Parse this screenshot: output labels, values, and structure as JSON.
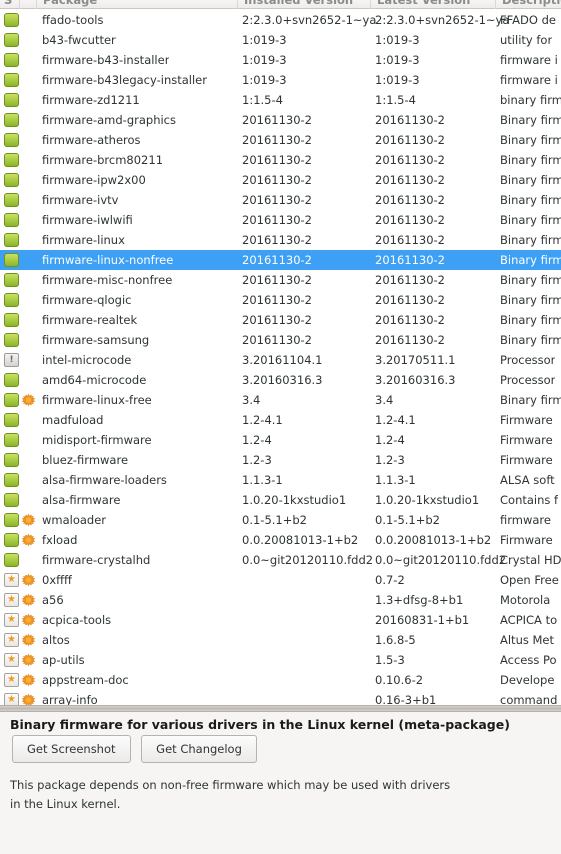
{
  "columns": {
    "status": "S",
    "package": "Package",
    "installed_version": "Installed Version",
    "latest_version": "Latest Version",
    "description": "Description"
  },
  "colors": {
    "selection": "#3da0f5",
    "installed_icon": "#8db528",
    "new_icon": "#f09a21",
    "supported_icon": "#f5941d"
  },
  "rows": [
    {
      "status": "installed",
      "supported": false,
      "name": "ffado-tools",
      "installed": "2:2.3.0+svn2652-1~ya",
      "latest": "2:2.3.0+svn2652-1~ya",
      "desc": "FFADO de"
    },
    {
      "status": "installed",
      "supported": false,
      "name": "b43-fwcutter",
      "installed": "1:019-3",
      "latest": "1:019-3",
      "desc": "utility for"
    },
    {
      "status": "installed",
      "supported": false,
      "name": "firmware-b43-installer",
      "installed": "1:019-3",
      "latest": "1:019-3",
      "desc": "firmware i"
    },
    {
      "status": "installed",
      "supported": false,
      "name": "firmware-b43legacy-installer",
      "installed": "1:019-3",
      "latest": "1:019-3",
      "desc": "firmware i"
    },
    {
      "status": "installed",
      "supported": false,
      "name": "firmware-zd1211",
      "installed": "1:1.5-4",
      "latest": "1:1.5-4",
      "desc": "binary firm"
    },
    {
      "status": "installed",
      "supported": false,
      "name": "firmware-amd-graphics",
      "installed": "20161130-2",
      "latest": "20161130-2",
      "desc": "Binary firm"
    },
    {
      "status": "installed",
      "supported": false,
      "name": "firmware-atheros",
      "installed": "20161130-2",
      "latest": "20161130-2",
      "desc": "Binary firm"
    },
    {
      "status": "installed",
      "supported": false,
      "name": "firmware-brcm80211",
      "installed": "20161130-2",
      "latest": "20161130-2",
      "desc": "Binary firm"
    },
    {
      "status": "installed",
      "supported": false,
      "name": "firmware-ipw2x00",
      "installed": "20161130-2",
      "latest": "20161130-2",
      "desc": "Binary firm"
    },
    {
      "status": "installed",
      "supported": false,
      "name": "firmware-ivtv",
      "installed": "20161130-2",
      "latest": "20161130-2",
      "desc": "Binary firm"
    },
    {
      "status": "installed",
      "supported": false,
      "name": "firmware-iwlwifi",
      "installed": "20161130-2",
      "latest": "20161130-2",
      "desc": "Binary firm"
    },
    {
      "status": "installed",
      "supported": false,
      "name": "firmware-linux",
      "installed": "20161130-2",
      "latest": "20161130-2",
      "desc": "Binary firm"
    },
    {
      "status": "installed",
      "supported": false,
      "selected": true,
      "name": "firmware-linux-nonfree",
      "installed": "20161130-2",
      "latest": "20161130-2",
      "desc": "Binary firm"
    },
    {
      "status": "installed",
      "supported": false,
      "name": "firmware-misc-nonfree",
      "installed": "20161130-2",
      "latest": "20161130-2",
      "desc": "Binary firm"
    },
    {
      "status": "installed",
      "supported": false,
      "name": "firmware-qlogic",
      "installed": "20161130-2",
      "latest": "20161130-2",
      "desc": "Binary firm"
    },
    {
      "status": "installed",
      "supported": false,
      "name": "firmware-realtek",
      "installed": "20161130-2",
      "latest": "20161130-2",
      "desc": "Binary firm"
    },
    {
      "status": "installed",
      "supported": false,
      "name": "firmware-samsung",
      "installed": "20161130-2",
      "latest": "20161130-2",
      "desc": "Binary firm"
    },
    {
      "status": "upgradable",
      "supported": false,
      "name": "intel-microcode",
      "installed": "3.20161104.1",
      "latest": "3.20170511.1",
      "desc": "Processor"
    },
    {
      "status": "installed",
      "supported": false,
      "name": "amd64-microcode",
      "installed": "3.20160316.3",
      "latest": "3.20160316.3",
      "desc": "Processor"
    },
    {
      "status": "installed",
      "supported": true,
      "name": "firmware-linux-free",
      "installed": "3.4",
      "latest": "3.4",
      "desc": "Binary firm"
    },
    {
      "status": "installed",
      "supported": false,
      "name": "madfuload",
      "installed": "1.2-4.1",
      "latest": "1.2-4.1",
      "desc": "Firmware"
    },
    {
      "status": "installed",
      "supported": false,
      "name": "midisport-firmware",
      "installed": "1.2-4",
      "latest": "1.2-4",
      "desc": "Firmware"
    },
    {
      "status": "installed",
      "supported": false,
      "name": "bluez-firmware",
      "installed": "1.2-3",
      "latest": "1.2-3",
      "desc": "Firmware"
    },
    {
      "status": "installed",
      "supported": false,
      "name": "alsa-firmware-loaders",
      "installed": "1.1.3-1",
      "latest": "1.1.3-1",
      "desc": "ALSA soft"
    },
    {
      "status": "installed",
      "supported": false,
      "name": "alsa-firmware",
      "installed": "1.0.20-1kxstudio1",
      "latest": "1.0.20-1kxstudio1",
      "desc": "Contains f"
    },
    {
      "status": "installed",
      "supported": true,
      "name": "wmaloader",
      "installed": "0.1-5.1+b2",
      "latest": "0.1-5.1+b2",
      "desc": "firmware"
    },
    {
      "status": "installed",
      "supported": true,
      "name": "fxload",
      "installed": "0.0.20081013-1+b2",
      "latest": "0.0.20081013-1+b2",
      "desc": "Firmware"
    },
    {
      "status": "installed",
      "supported": false,
      "name": "firmware-crystalhd",
      "installed": "0.0~git20120110.fdd2",
      "latest": "0.0~git20120110.fdd2",
      "desc": "Crystal HD"
    },
    {
      "status": "new",
      "supported": true,
      "name": "0xffff",
      "installed": "",
      "latest": "0.7-2",
      "desc": "Open Free"
    },
    {
      "status": "new",
      "supported": true,
      "name": "a56",
      "installed": "",
      "latest": "1.3+dfsg-8+b1",
      "desc": "Motorola"
    },
    {
      "status": "new",
      "supported": true,
      "name": "acpica-tools",
      "installed": "",
      "latest": "20160831-1+b1",
      "desc": "ACPICA to"
    },
    {
      "status": "new",
      "supported": true,
      "name": "altos",
      "installed": "",
      "latest": "1.6.8-5",
      "desc": "Altus Met"
    },
    {
      "status": "new",
      "supported": true,
      "name": "ap-utils",
      "installed": "",
      "latest": "1.5-3",
      "desc": "Access Po"
    },
    {
      "status": "new",
      "supported": true,
      "name": "appstream-doc",
      "installed": "",
      "latest": "0.10.6-2",
      "desc": "Develope"
    },
    {
      "status": "new",
      "supported": true,
      "name": "array-info",
      "installed": "",
      "latest": "0.16-3+b1",
      "desc": "command"
    }
  ],
  "details": {
    "title": "Binary firmware for various drivers in the Linux kernel (meta-package)",
    "get_screenshot_label": "Get Screenshot",
    "get_changelog_label": "Get Changelog",
    "description_lines": [
      "This package depends on non-free firmware which may be used with drivers",
      "in the Linux kernel."
    ]
  }
}
